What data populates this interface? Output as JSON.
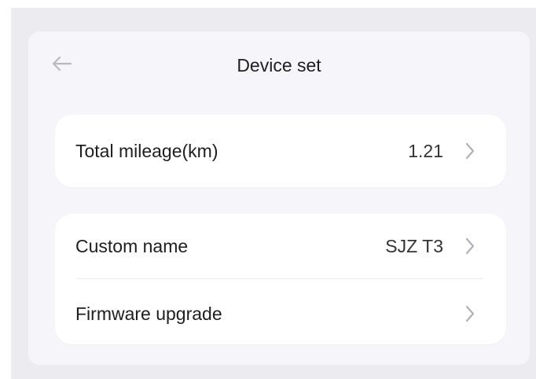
{
  "header": {
    "title": "Device set",
    "back_icon": "arrow-left-icon"
  },
  "mileage_card": {
    "label": "Total mileage(km)",
    "value": "1.21",
    "icon": "chevron-right-icon"
  },
  "settings_card": {
    "items": [
      {
        "label": "Custom name",
        "value": "SJZ T3",
        "icon": "chevron-right-icon"
      },
      {
        "label": "Firmware upgrade",
        "value": "",
        "icon": "chevron-right-icon"
      }
    ]
  },
  "colors": {
    "background": "#ebebf0",
    "panel": "#f6f6fa",
    "card": "#ffffff",
    "text": "#1e1e1e",
    "chevron": "#b0b0b8"
  }
}
